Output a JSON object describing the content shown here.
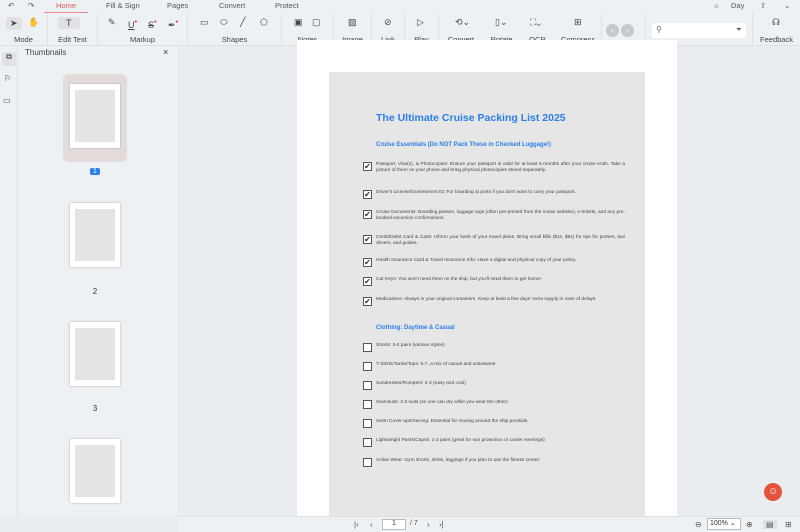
{
  "tabs": [
    "Home",
    "Fill & Sign",
    "Pages",
    "Convert",
    "Protect"
  ],
  "theme": "Day",
  "toolbar": {
    "mode": "Mode",
    "edit_text": "Edit Text",
    "markup": "Markup",
    "shapes": "Shapes",
    "notes": "Notes",
    "image": "Image",
    "link": "Link",
    "play": "Play",
    "convert": "Convert",
    "rotate": "Rotate",
    "ocr": "OCR",
    "compress": "Compress",
    "feedback": "Feedback"
  },
  "sidebar": {
    "title": "Thumbnails",
    "pages": [
      "1",
      "2",
      "3"
    ]
  },
  "document": {
    "title": "The Ultimate Cruise Packing List 2025",
    "section1": "Cruise Essentials (Do NOT Pack These in Checked Luggage!)",
    "items1": [
      "Passport, Visa(s), & Photocopies: Ensure your passport is valid for at least 6 months after your cruise ends. Take a picture of them on your phone and bring physical photocopies stored separately.",
      "Driver's License/Government ID: For boarding at ports if you don't want to carry your passport.",
      "Cruise Documents: Boarding passes, luggage tags (often pre-printed from the cruise website), e-tickets, and any pre-booked excursion confirmations.",
      "Credit/Debit Card & Cash: Inform your bank of your travel plans. Bring small bills ($1s, $5s) for tips for porters, taxi drivers, and guides.",
      "Health Insurance Card & Travel Insurance Info: Have a digital and physical copy of your policy.",
      "Car Keys: You won't need them on the ship, but you'll need them to get home!",
      "Medications: Always in your original containers. Keep at least a few days' extra supply in case of delays."
    ],
    "section2": "Clothing: Daytime & Casual",
    "items2": [
      "Shorts: 3-4 pairs (various styles)",
      "T-Shirts/Tanks/Tops: 5-7, a mix of casual and activewear",
      "Sundresses/Rompers: 2-3 (easy and cool)",
      "Swimsuits: 2-3 suits (so one can dry while you wear the other)",
      "Swim Cover-ups/Sarong: Essential for moving around the ship poolside.",
      "Lightweight Pants/Capris: 1-2 pairs (great for sun protection or cooler evenings)",
      "Active Wear: Gym shorts, shirts, leggings if you plan to use the fitness center."
    ]
  },
  "pager": {
    "current": "1",
    "total": "/ 7",
    "zoom": "100%"
  },
  "colors": {
    "accent": "#e05a5a",
    "heading": "#2a7fe8"
  }
}
